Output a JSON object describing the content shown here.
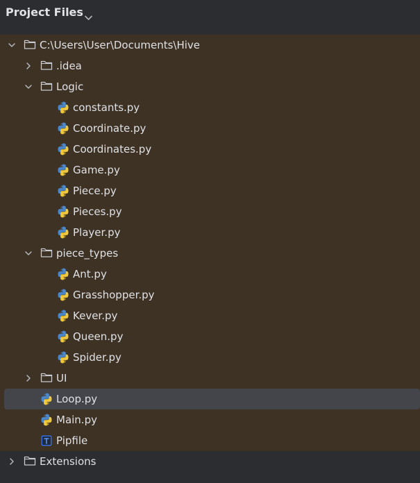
{
  "panel": {
    "title": "Project Files"
  },
  "tree": [
    {
      "label": "C:\\Users\\User\\Documents\\Hive",
      "type": "folder",
      "depth": 0,
      "expanded": true
    },
    {
      "label": ".idea",
      "type": "folder",
      "depth": 1,
      "expanded": false
    },
    {
      "label": "Logic",
      "type": "folder",
      "depth": 1,
      "expanded": true
    },
    {
      "label": "constants.py",
      "type": "python",
      "depth": 2
    },
    {
      "label": "Coordinate.py",
      "type": "python",
      "depth": 2
    },
    {
      "label": "Coordinates.py",
      "type": "python",
      "depth": 2
    },
    {
      "label": "Game.py",
      "type": "python",
      "depth": 2
    },
    {
      "label": "Piece.py",
      "type": "python",
      "depth": 2
    },
    {
      "label": "Pieces.py",
      "type": "python",
      "depth": 2
    },
    {
      "label": "Player.py",
      "type": "python",
      "depth": 2
    },
    {
      "label": "piece_types",
      "type": "folder",
      "depth": 1,
      "expanded": true
    },
    {
      "label": "Ant.py",
      "type": "python",
      "depth": 2
    },
    {
      "label": "Grasshopper.py",
      "type": "python",
      "depth": 2
    },
    {
      "label": "Kever.py",
      "type": "python",
      "depth": 2
    },
    {
      "label": "Queen.py",
      "type": "python",
      "depth": 2
    },
    {
      "label": "Spider.py",
      "type": "python",
      "depth": 2
    },
    {
      "label": "UI",
      "type": "folder",
      "depth": 1,
      "expanded": false
    },
    {
      "label": "Loop.py",
      "type": "python",
      "depth": 1,
      "selected": true
    },
    {
      "label": "Main.py",
      "type": "python",
      "depth": 1
    },
    {
      "label": "Pipfile",
      "type": "text",
      "depth": 1
    },
    {
      "label": "Extensions",
      "type": "folder",
      "depth": 0,
      "expanded": false
    }
  ],
  "icons": {
    "folder": "folder-icon",
    "python": "python-file-icon",
    "text": "text-file-icon",
    "chevron_down": "chevron-down-icon",
    "chevron_right": "chevron-right-icon"
  },
  "colors": {
    "panel_background": "#2b2d30",
    "project_background": "#3e3225",
    "selection": "#43454a",
    "text": "#dfe1e5",
    "python_blue": "#4a86c8",
    "python_yellow": "#f0c83c",
    "text_file_blue": "#3574f0"
  }
}
